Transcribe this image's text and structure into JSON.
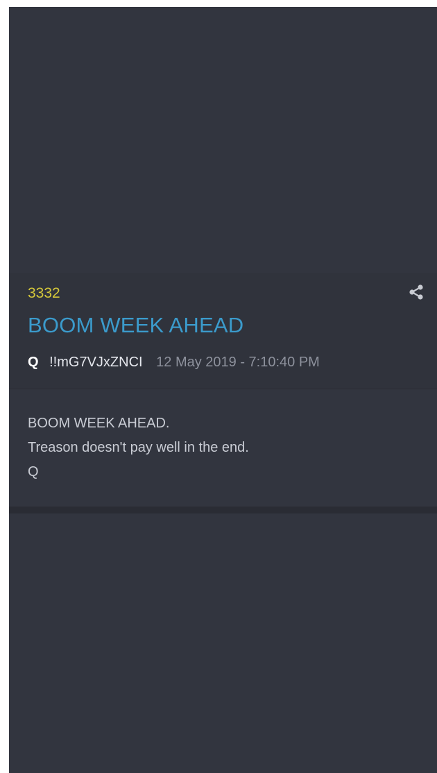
{
  "post": {
    "number": "3332",
    "title": "BOOM WEEK AHEAD",
    "author": "Q",
    "tripcode": "!!mG7VJxZNCI",
    "timestamp": "12 May 2019 - 7:10:40 PM",
    "body_lines": [
      "BOOM WEEK AHEAD.",
      "Treason doesn't pay well in the end.",
      "Q"
    ],
    "share_icon": "share-icon"
  },
  "colors": {
    "background": "#32353f",
    "number": "#d4c73a",
    "title": "#3b9bcc",
    "author": "#ffffff",
    "timestamp": "#8d919c",
    "body_text": "#c9ccd4"
  }
}
